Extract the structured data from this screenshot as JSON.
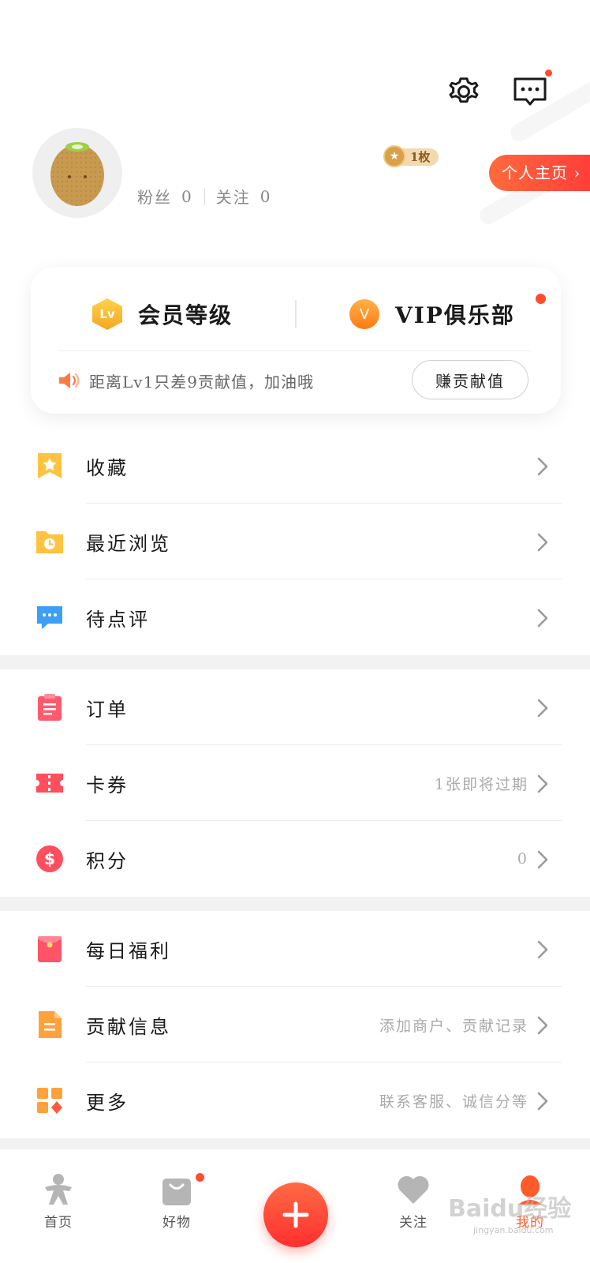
{
  "header": {
    "settings_icon": "gear-icon",
    "message_icon": "message-icon",
    "fans_label": "粉丝",
    "fans_count": "0",
    "following_label": "关注",
    "following_count": "0",
    "medal_count": "1枚",
    "homepage_label": "个人主页 ›"
  },
  "member_card": {
    "level_badge": "Lv",
    "level_title": "会员等级",
    "vip_badge": "V",
    "vip_title": "VIP俱乐部",
    "tip_text": "距离Lv1只差9贡献值，加油哦",
    "earn_button": "赚贡献值"
  },
  "menu_sections": [
    [
      {
        "label": "收藏",
        "value": "",
        "icon": "bookmark-star-icon"
      },
      {
        "label": "最近浏览",
        "value": "",
        "icon": "history-folder-icon"
      },
      {
        "label": "待点评",
        "value": "",
        "icon": "comment-icon"
      }
    ],
    [
      {
        "label": "订单",
        "value": "",
        "icon": "clipboard-icon"
      },
      {
        "label": "卡券",
        "value": "1张即将过期",
        "icon": "ticket-icon"
      },
      {
        "label": "积分",
        "value": "0",
        "icon": "dollar-coin-icon"
      }
    ],
    [
      {
        "label": "每日福利",
        "value": "",
        "icon": "red-envelope-icon"
      },
      {
        "label": "贡献信息",
        "value": "添加商户、贡献记录",
        "icon": "document-icon"
      },
      {
        "label": "更多",
        "value": "联系客服、诚信分等",
        "icon": "grid-icon"
      }
    ]
  ],
  "tabbar": {
    "tabs": [
      {
        "label": "首页",
        "icon": "home-person-icon"
      },
      {
        "label": "好物",
        "icon": "shopping-bag-icon"
      },
      {
        "label": "关注",
        "icon": "heart-icon"
      },
      {
        "label": "我的",
        "icon": "profile-icon"
      }
    ],
    "fab_icon": "plus-icon"
  },
  "watermark": {
    "text": "Baidu经验",
    "sub": "jingyan.baidu.com"
  },
  "colors": {
    "accent": "#ff4d2d",
    "divider": "#ececec",
    "gap": "#f2f2f2"
  }
}
